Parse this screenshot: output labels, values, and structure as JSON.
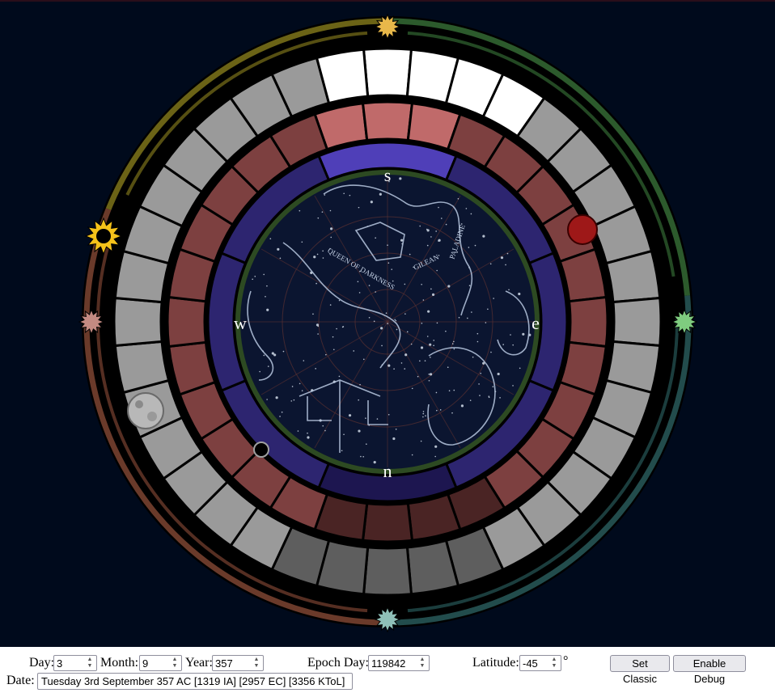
{
  "wheel": {
    "directions": {
      "north": "n",
      "south": "s",
      "east": "e",
      "west": "w"
    },
    "constellation_labels": [
      "QUEEN OF DARKNESS",
      "GILEAN",
      "PALADINE"
    ],
    "colors": {
      "background": "#000a1c",
      "silver": "#9a9a9a",
      "white": "#ffffff",
      "red": "#7d4040",
      "red_bright": "#c06a6a",
      "blue": "#2d2570",
      "blue_bright": "#4f3fb8",
      "sky": "#0b1530",
      "star_lines": "#b8c8e0",
      "outer_yellow": "#6b6316",
      "outer_green": "#2c5a2c",
      "outer_teal": "#224c4c",
      "outer_brown": "#6a3a2a"
    },
    "icons": {
      "top_star": "sun-burst-gold-icon",
      "right_star": "sun-burst-green-icon",
      "bottom_star": "sun-burst-teal-icon",
      "left_star": "sun-burst-pink-icon",
      "sun": "sun-icon",
      "red_moon": "red-moon-icon",
      "white_moon": "white-moon-icon",
      "black_moon": "black-moon-icon"
    }
  },
  "controls": {
    "day_label": "Day:",
    "day_value": "3",
    "month_label": "Month:",
    "month_value": "9",
    "year_label": "Year:",
    "year_value": "357",
    "epoch_label": "Epoch Day:",
    "epoch_value": "119842",
    "latitude_label": "Latitude:",
    "latitude_value": "-45",
    "latitude_unit": "°",
    "set_classic_label": "Set Classic",
    "enable_debug_label": "Enable Debug",
    "date_label": "Date:",
    "date_value": "Tuesday 3rd September 357 AC [1319 IA] [2957 EC] [3356 KToL]"
  }
}
